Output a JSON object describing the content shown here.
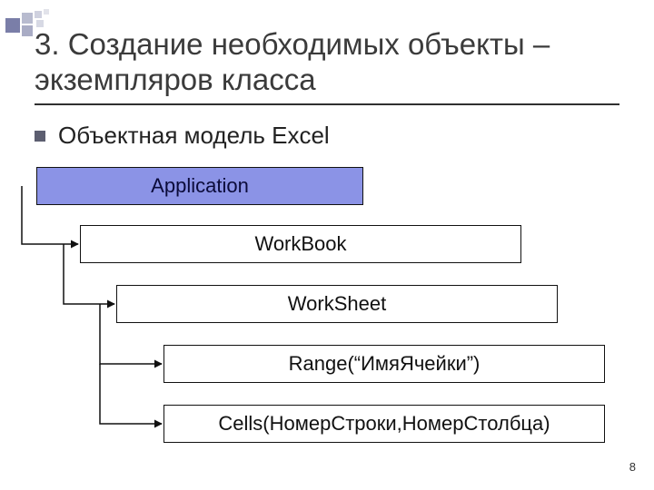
{
  "title": "3. Создание необходимых объекты – экземпляров класса",
  "bullet": "Объектная модель Excel",
  "diagram": {
    "app": {
      "label": "Application"
    },
    "workbook": {
      "label": "WorkBook"
    },
    "worksheet": {
      "label": "WorkSheet"
    },
    "range": {
      "label": "Range(“ИмяЯчейки”)"
    },
    "cells": {
      "label": "Cells(НомерСтроки,НомерСтолбца)"
    }
  },
  "page_number": "8"
}
